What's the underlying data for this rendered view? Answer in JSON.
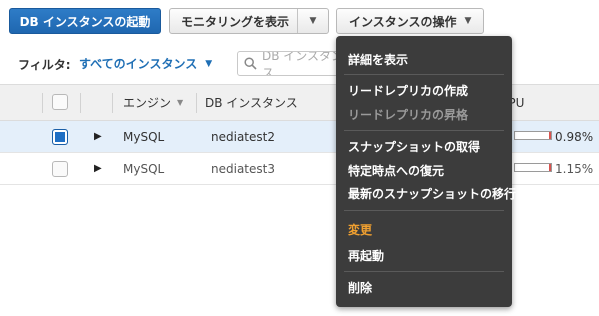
{
  "toolbar": {
    "launch_label": "DB インスタンスの起動",
    "monitor_label": "モニタリングを表示",
    "actions_label": "インスタンスの操作"
  },
  "filter": {
    "label": "フィルタ:",
    "selected": "すべてのインスタンス",
    "search_placeholder": "DB インスタンス"
  },
  "table": {
    "columns": [
      "エンジン",
      "DB インスタンス",
      "CPU"
    ],
    "rows": [
      {
        "engine": "MySQL",
        "instance": "nediatest2",
        "cpu": "0.98%",
        "cpu_fraction": 0.0098,
        "selected": true
      },
      {
        "engine": "MySQL",
        "instance": "nediatest3",
        "cpu": "1.15%",
        "cpu_fraction": 0.0115,
        "selected": false
      }
    ]
  },
  "menu": {
    "items": [
      {
        "label": "詳細を表示",
        "state": "normal"
      },
      {
        "label": "リードレプリカの作成",
        "state": "normal"
      },
      {
        "label": "リードレプリカの昇格",
        "state": "disabled"
      },
      {
        "label": "スナップショットの取得",
        "state": "normal"
      },
      {
        "label": "特定時点への復元",
        "state": "normal"
      },
      {
        "label": "最新のスナップショットの移行",
        "state": "normal"
      },
      {
        "label": "変更",
        "state": "highlighted"
      },
      {
        "label": "再起動",
        "state": "normal"
      },
      {
        "label": "削除",
        "state": "normal"
      }
    ]
  },
  "colors": {
    "primary": "#1f67b0",
    "link": "#1f6fb5",
    "menu_bg": "#3c3c3c",
    "menu_highlight": "#f0a030",
    "cpu_bar": "#d9534f",
    "selected_row": "#e4effa"
  }
}
